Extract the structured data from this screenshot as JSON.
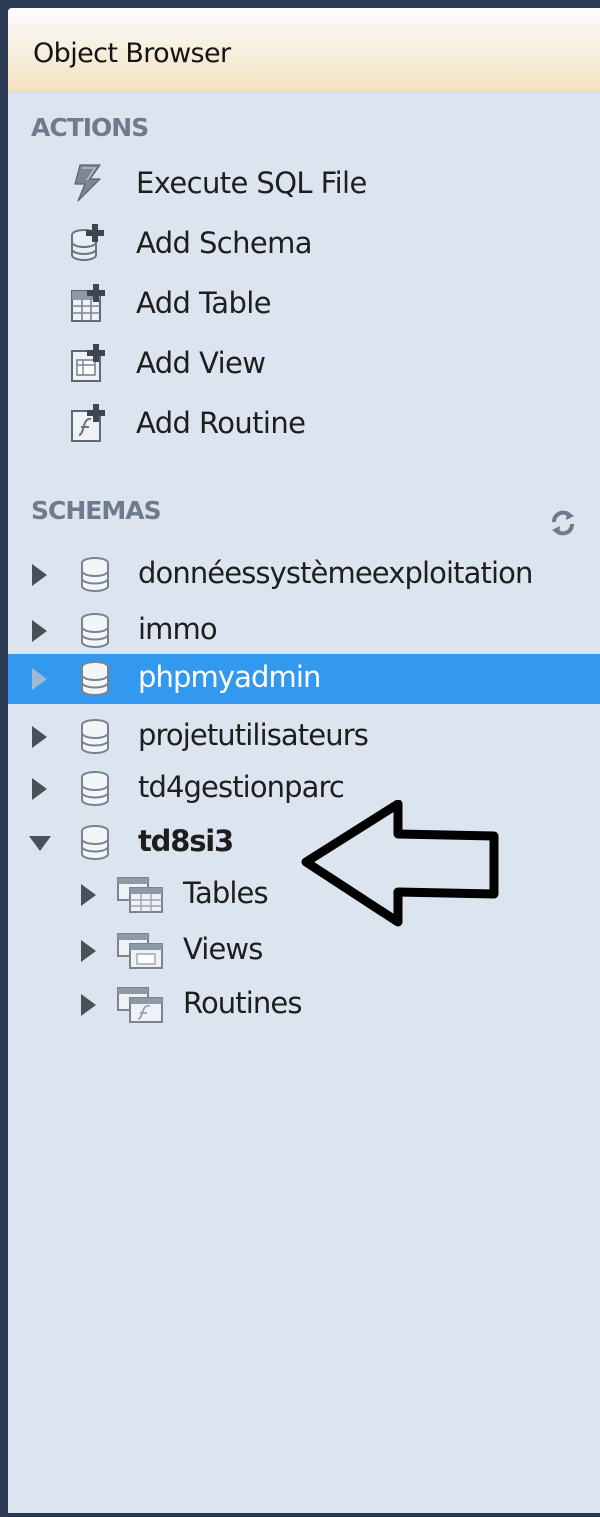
{
  "panel": {
    "title": "Object Browser"
  },
  "actions": {
    "header": "ACTIONS",
    "items": [
      {
        "label": "Execute SQL File",
        "icon": "lightning-icon"
      },
      {
        "label": "Add Schema",
        "icon": "add-schema-icon"
      },
      {
        "label": "Add Table",
        "icon": "add-table-icon"
      },
      {
        "label": "Add View",
        "icon": "add-view-icon"
      },
      {
        "label": "Add Routine",
        "icon": "add-routine-icon"
      }
    ]
  },
  "schemas": {
    "header": "SCHEMAS",
    "items": [
      {
        "label": "donnéessystèmeexploitation",
        "expanded": false,
        "selected": false
      },
      {
        "label": "immo",
        "expanded": false,
        "selected": false
      },
      {
        "label": "phpmyadmin",
        "expanded": false,
        "selected": true
      },
      {
        "label": "projetutilisateurs",
        "expanded": false,
        "selected": false
      },
      {
        "label": "td4gestionparc",
        "expanded": false,
        "selected": false
      },
      {
        "label": "td8si3",
        "expanded": true,
        "selected": false,
        "bold": true
      }
    ],
    "children": [
      {
        "label": "Tables",
        "icon": "tables-folder-icon"
      },
      {
        "label": "Views",
        "icon": "views-folder-icon"
      },
      {
        "label": "Routines",
        "icon": "routines-folder-icon"
      }
    ]
  },
  "colors": {
    "panel_bg": "#dce5ef",
    "selection": "#3399ee",
    "section_header": "#6d7b8c"
  }
}
